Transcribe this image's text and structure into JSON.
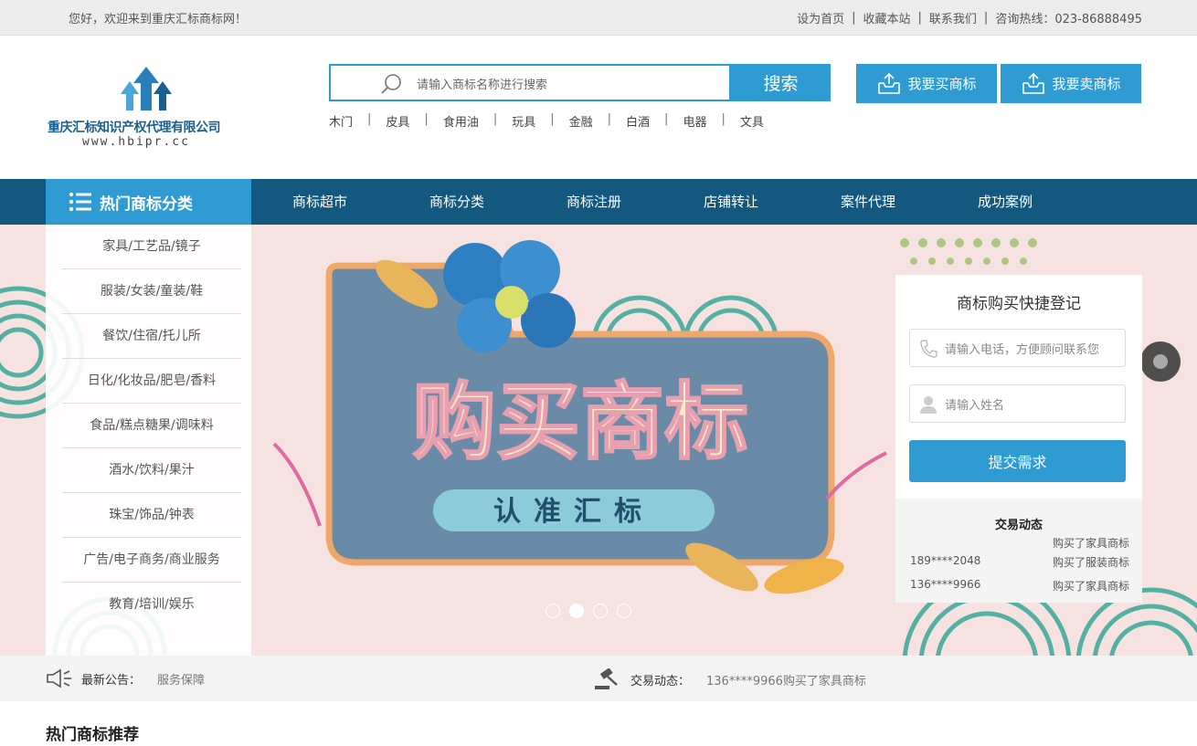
{
  "topbar": {
    "welcome": "您好，欢迎来到重庆汇标商标网！",
    "set_home": "设为首页",
    "bookmark": "收藏本站",
    "contact": "联系我们",
    "hotline": "咨询热线：023-86888495"
  },
  "logo": {
    "company": "重庆汇标知识产权代理有限公司",
    "url": "www.hbipr.cc"
  },
  "search": {
    "placeholder": "请输入商标名称进行搜索",
    "button": "搜索"
  },
  "actions": {
    "buy": "我要买商标",
    "sell": "我要卖商标"
  },
  "hot_words": [
    "木门",
    "皮具",
    "食用油",
    "玩具",
    "金融",
    "白酒",
    "电器",
    "文具"
  ],
  "nav": {
    "category_title": "热门商标分类",
    "items": [
      "商标超市",
      "商标分类",
      "商标注册",
      "店铺转让",
      "案件代理",
      "成功案例"
    ]
  },
  "categories": [
    "家具/工艺品/镜子",
    "服装/女装/童装/鞋",
    "餐饮/住宿/托儿所",
    "日化/化妆品/肥皂/香料",
    "食品/糕点糖果/调味料",
    "酒水/饮料/果汁",
    "珠宝/饰品/钟表",
    "广告/电子商务/商业服务",
    "教育/培训/娱乐"
  ],
  "banner": {
    "headline": "购买商标",
    "tagline": "认准汇标",
    "slides_total": 4,
    "active_slide": 2
  },
  "quick_form": {
    "title": "商标购买快捷登记",
    "phone_placeholder": "请输入电话，方便顾问联系您",
    "name_placeholder": "请输入姓名",
    "submit": "提交需求"
  },
  "trade_box": {
    "title": "交易动态",
    "rows": [
      {
        "phone": "",
        "action": "购买了家具商标"
      },
      {
        "phone": "189****2048",
        "action": "购买了服装商标"
      },
      {
        "phone": "136****9966",
        "action": "购买了家具商标"
      }
    ]
  },
  "notice": {
    "label": "最新公告：",
    "text": "服务保障",
    "trade_label": "交易动态：",
    "trade_text": "136****9966购买了家具商标"
  },
  "section": {
    "hot_title": "热门商标推荐"
  },
  "colors": {
    "accent": "#2e9cd3",
    "nav_bg": "#13587f",
    "banner_bg": "#f6e3e1"
  }
}
